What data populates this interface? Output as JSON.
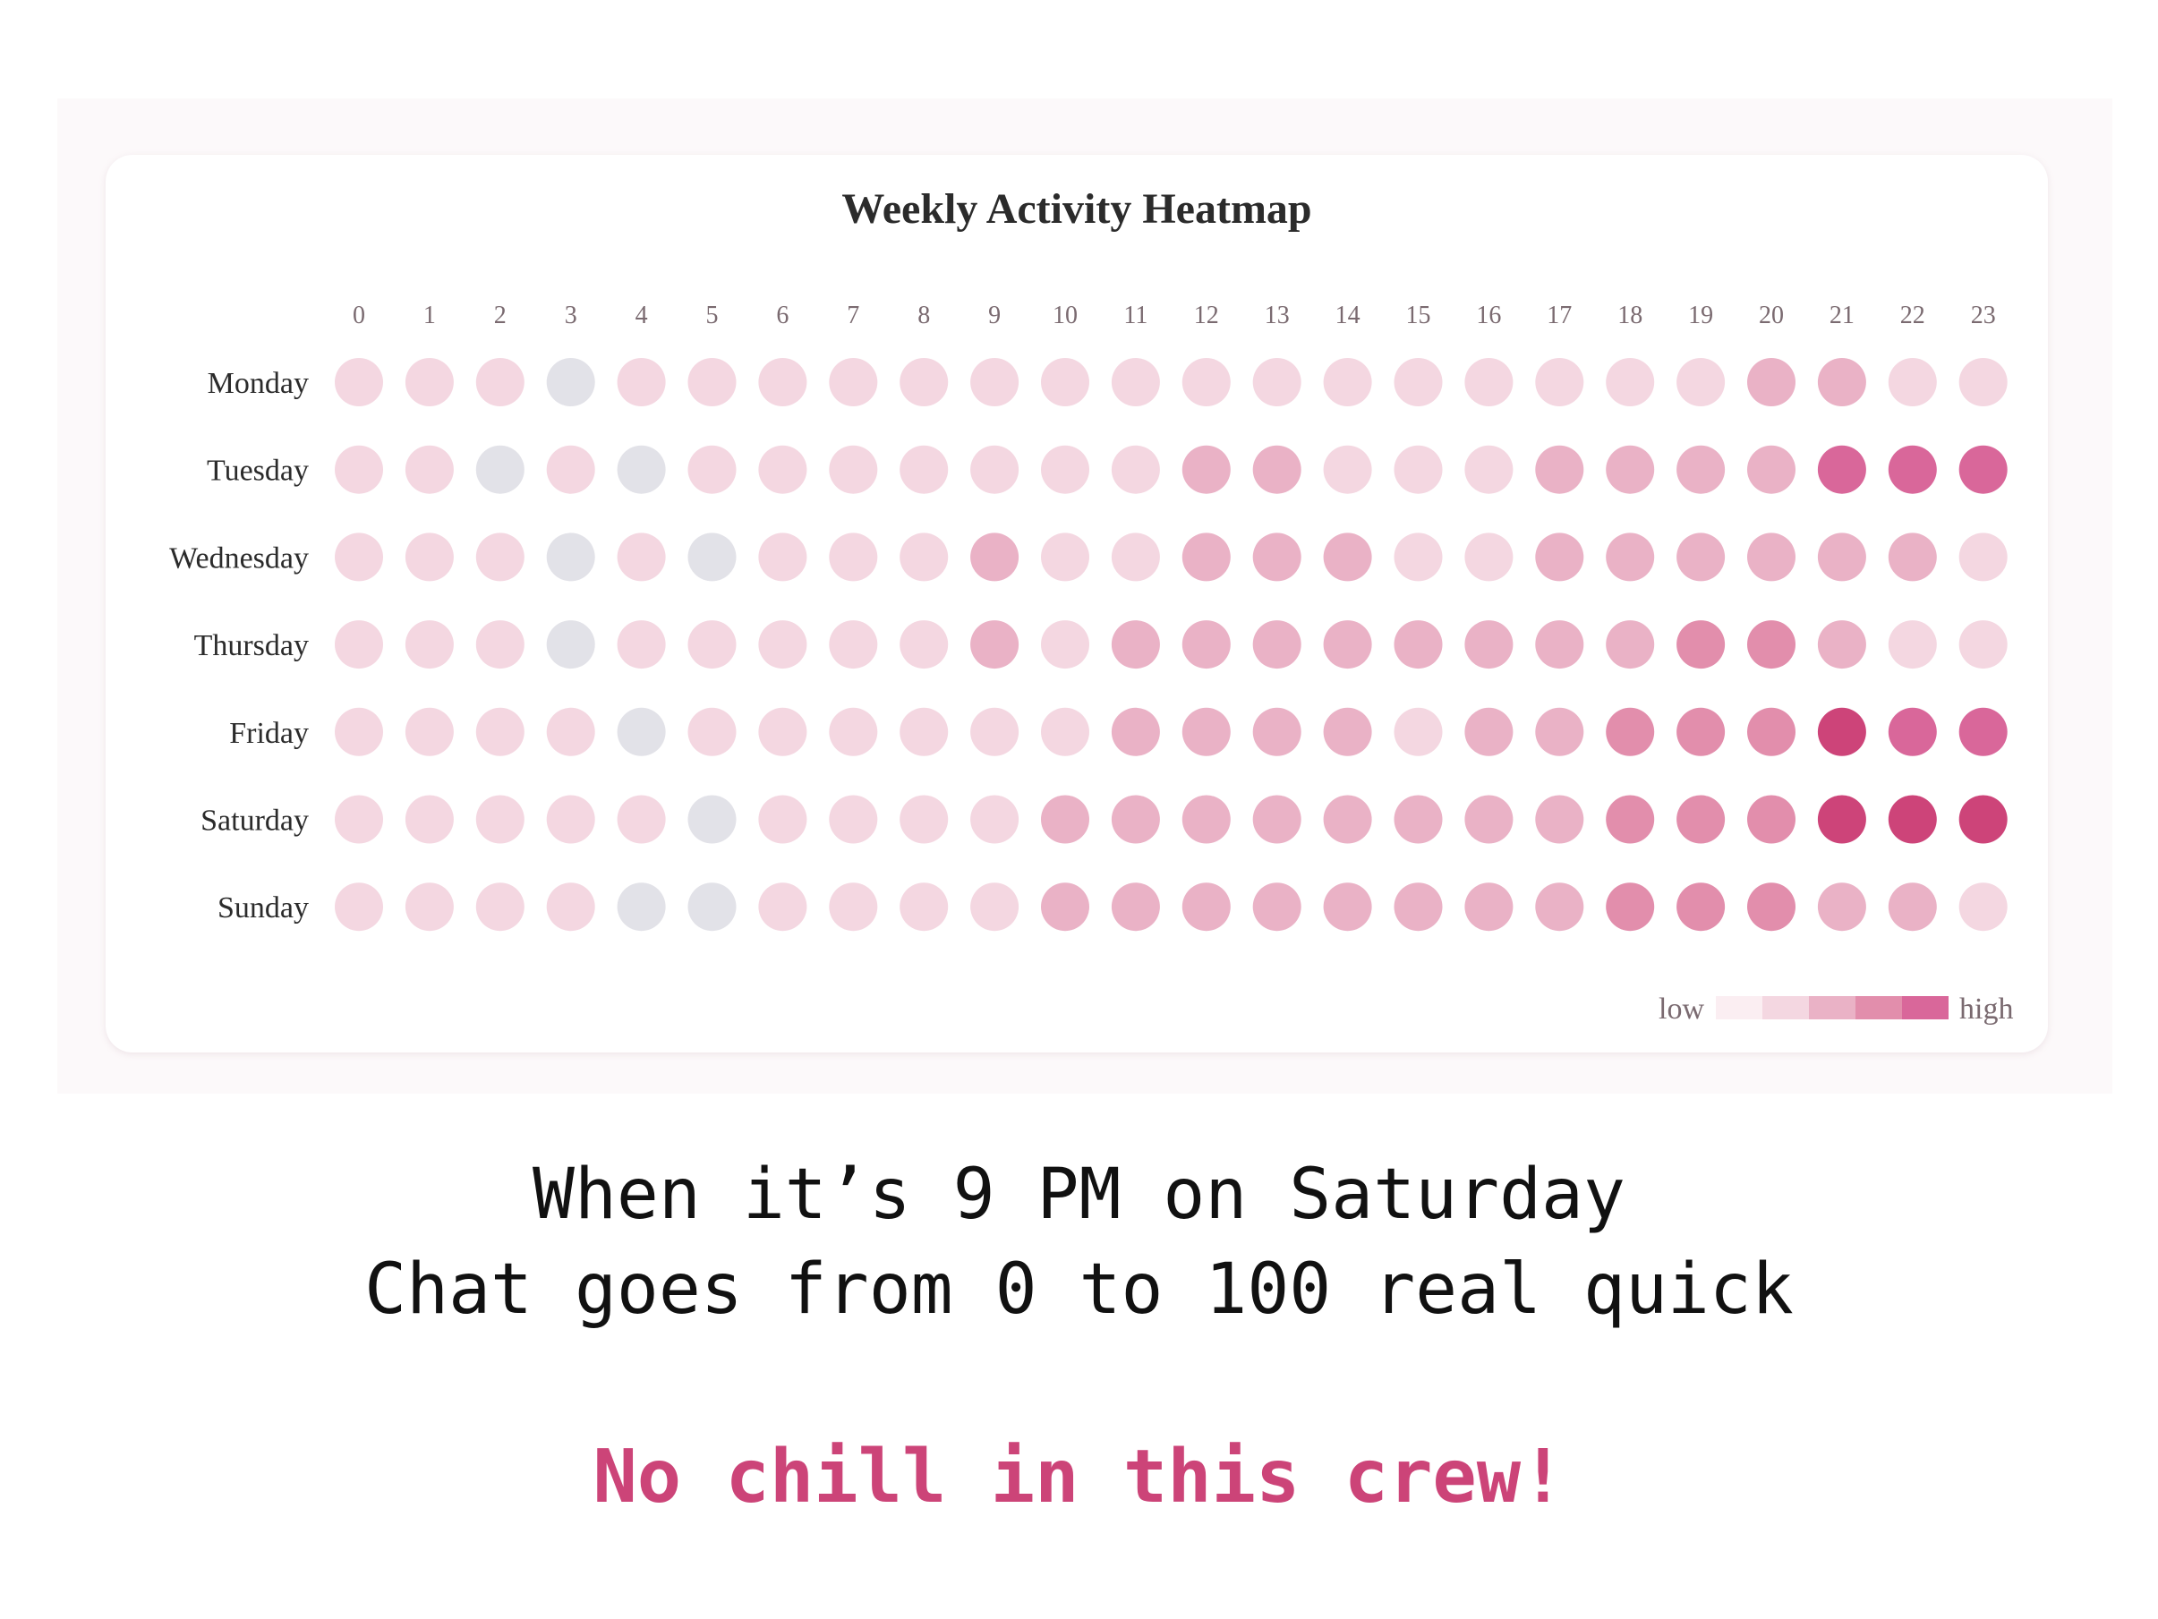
{
  "chart_data": {
    "type": "heatmap",
    "title": "Weekly Activity Heatmap",
    "x_categories": [
      "0",
      "1",
      "2",
      "3",
      "4",
      "5",
      "6",
      "7",
      "8",
      "9",
      "10",
      "11",
      "12",
      "13",
      "14",
      "15",
      "16",
      "17",
      "18",
      "19",
      "20",
      "21",
      "22",
      "23"
    ],
    "y_categories": [
      "Monday",
      "Tuesday",
      "Wednesday",
      "Thursday",
      "Friday",
      "Saturday",
      "Sunday"
    ],
    "levels": [
      [
        1,
        1,
        1,
        0,
        1,
        1,
        1,
        1,
        1,
        1,
        1,
        1,
        1,
        1,
        1,
        1,
        1,
        1,
        1,
        1,
        2,
        2,
        1,
        1
      ],
      [
        1,
        1,
        0,
        1,
        0,
        1,
        1,
        1,
        1,
        1,
        1,
        1,
        2,
        2,
        1,
        1,
        1,
        2,
        2,
        2,
        2,
        4,
        4,
        4
      ],
      [
        1,
        1,
        1,
        0,
        1,
        0,
        1,
        1,
        1,
        2,
        1,
        1,
        2,
        2,
        2,
        1,
        1,
        2,
        2,
        2,
        2,
        2,
        2,
        1
      ],
      [
        1,
        1,
        1,
        0,
        1,
        1,
        1,
        1,
        1,
        2,
        1,
        2,
        2,
        2,
        2,
        2,
        2,
        2,
        2,
        3,
        3,
        2,
        1,
        1
      ],
      [
        1,
        1,
        1,
        1,
        0,
        1,
        1,
        1,
        1,
        1,
        1,
        2,
        2,
        2,
        2,
        1,
        2,
        2,
        3,
        3,
        3,
        5,
        4,
        4
      ],
      [
        1,
        1,
        1,
        1,
        1,
        0,
        1,
        1,
        1,
        1,
        2,
        2,
        2,
        2,
        2,
        2,
        2,
        2,
        3,
        3,
        3,
        5,
        5,
        5
      ],
      [
        1,
        1,
        1,
        1,
        0,
        0,
        1,
        1,
        1,
        1,
        2,
        2,
        2,
        2,
        2,
        2,
        2,
        2,
        3,
        3,
        3,
        2,
        2,
        1
      ]
    ],
    "level_colors": [
      "#e2e2e8",
      "#f4d7e1",
      "#eab2c6",
      "#e28eac",
      "#d9679a",
      "#cd4479"
    ],
    "legend": {
      "low_label": "low",
      "high_label": "high",
      "placement": "bottom-right",
      "colors": [
        "#fbeef2",
        "#f4d7e1",
        "#eab2c6",
        "#e28eac",
        "#d9679a"
      ]
    }
  },
  "caption": {
    "line1": "When it’s 9 PM on Saturday",
    "line2": "Chat goes from 0 to 100 real quick",
    "punchline": "No chill in this crew!",
    "punchline_color": "#cc4478"
  }
}
